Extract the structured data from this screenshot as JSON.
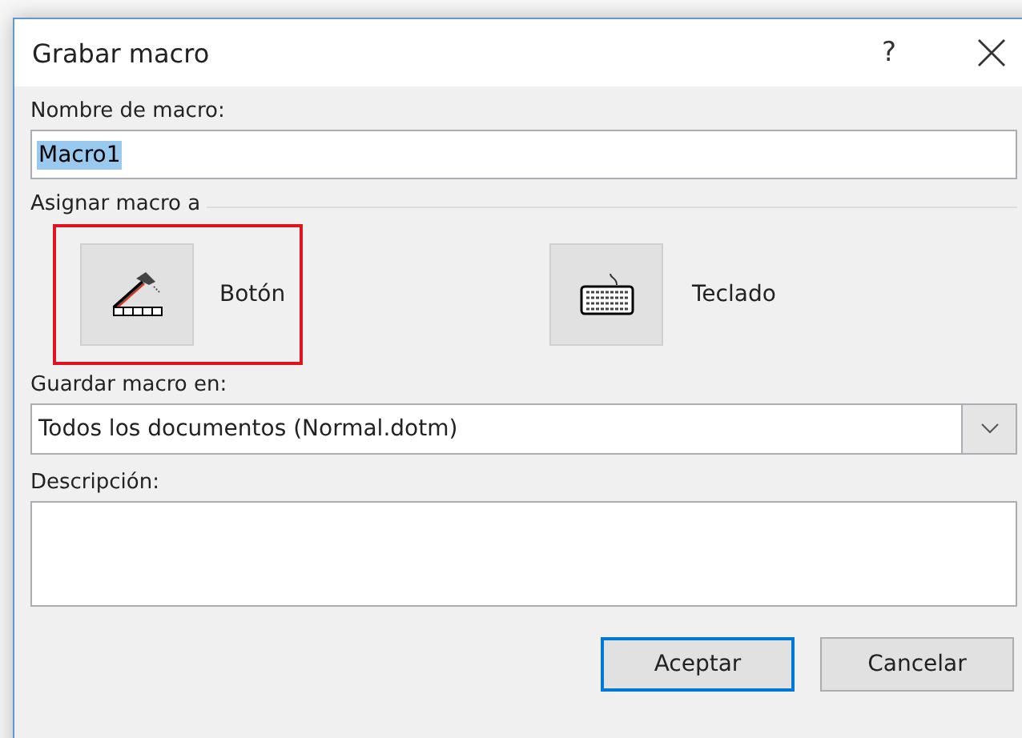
{
  "window": {
    "title": "Grabar macro",
    "help": "?"
  },
  "name_field": {
    "label": "Nombre de macro:",
    "value": "Macro1",
    "text_selected": true
  },
  "assign": {
    "label": "Asignar macro a",
    "options": [
      {
        "kind": "button",
        "label": "Botón",
        "highlighted": true
      },
      {
        "kind": "keyboard",
        "label": "Teclado",
        "highlighted": false
      }
    ]
  },
  "store_in": {
    "label": "Guardar macro en:",
    "value": "Todos los documentos (Normal.dotm)"
  },
  "description": {
    "label": "Descripción:"
  },
  "buttons": [
    {
      "label": "Aceptar",
      "default": true
    },
    {
      "label": "Cancelar",
      "default": false
    }
  ]
}
